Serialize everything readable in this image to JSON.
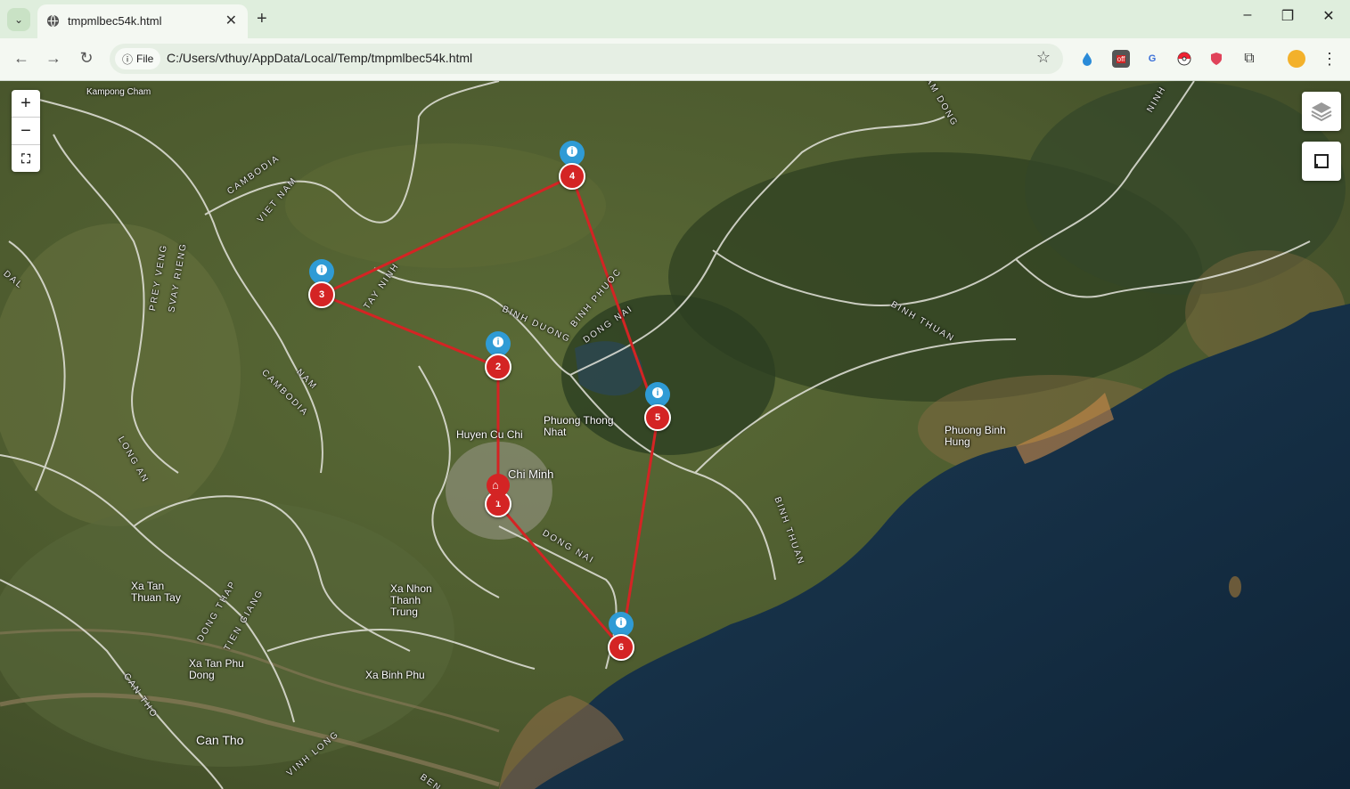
{
  "browser": {
    "tab_title": "tmpmlbec54k.html",
    "file_chip": "File",
    "url": "C:/Users/vthuy/AppData/Local/Temp/tmpmlbec54k.html",
    "extension_badge": "off"
  },
  "map": {
    "zoom_in": "+",
    "zoom_out": "−",
    "route_color": "#d42424",
    "info_pin_color": "#2f9bd5",
    "home_pin_color": "#d42424",
    "stops": [
      {
        "label": "1",
        "info_pin": false,
        "home_pin": true
      },
      {
        "label": "2",
        "info_pin": true
      },
      {
        "label": "3",
        "info_pin": true
      },
      {
        "label": "4",
        "info_pin": true
      },
      {
        "label": "5",
        "info_pin": true
      },
      {
        "label": "6",
        "info_pin": true
      }
    ],
    "route_order": [
      "1",
      "2",
      "3",
      "4",
      "5",
      "6",
      "1"
    ],
    "place_labels": {
      "kampong_cham": "Kampong Cham",
      "cambodia_1": "CAMBODIA",
      "viet_nam_1": "VIET NAM",
      "prey_veng": "PREY VENG",
      "svay_rieng": "SVAY RIENG",
      "tay_ninh": "TAY NINH",
      "binh_duong": "BINH DUONG",
      "binh_phuoc": "BINH PHUOC",
      "dong_nai_1": "DONG NAI",
      "dong_nai_2": "DONG NAI",
      "binh_thuan_1": "BINH THUAN",
      "binh_thuan_2": "BINH THUAN",
      "lam_dong": "LAM DONG",
      "ninh": "NINH",
      "nam": "NAM",
      "cambodia_2": "CAMBODIA",
      "long_an": "LONG AN",
      "huyen_cu_chi": "Huyen Cu Chi",
      "phuong_thong_nhat": "Phuong Thong Nhat",
      "ho_chi_minh": "Chi Minh",
      "phuong_binh_hung": "Phuong Binh Hung",
      "xa_tan_thuan_tay": "Xa Tan Thuan Tay",
      "xa_nhon_thanh_trung": "Xa Nhon Thanh Trung",
      "dong_thap": "DONG THAP",
      "tien_giang": "TIEN GIANG",
      "xa_tan_phu_dong": "Xa Tan Phu Dong",
      "xa_binh_phu": "Xa Binh Phu",
      "can_tho_prov": "CAN THO",
      "can_tho": "Can Tho",
      "vinh_long": "VINH LONG",
      "ben": "BEN",
      "dal": "DAL"
    }
  }
}
